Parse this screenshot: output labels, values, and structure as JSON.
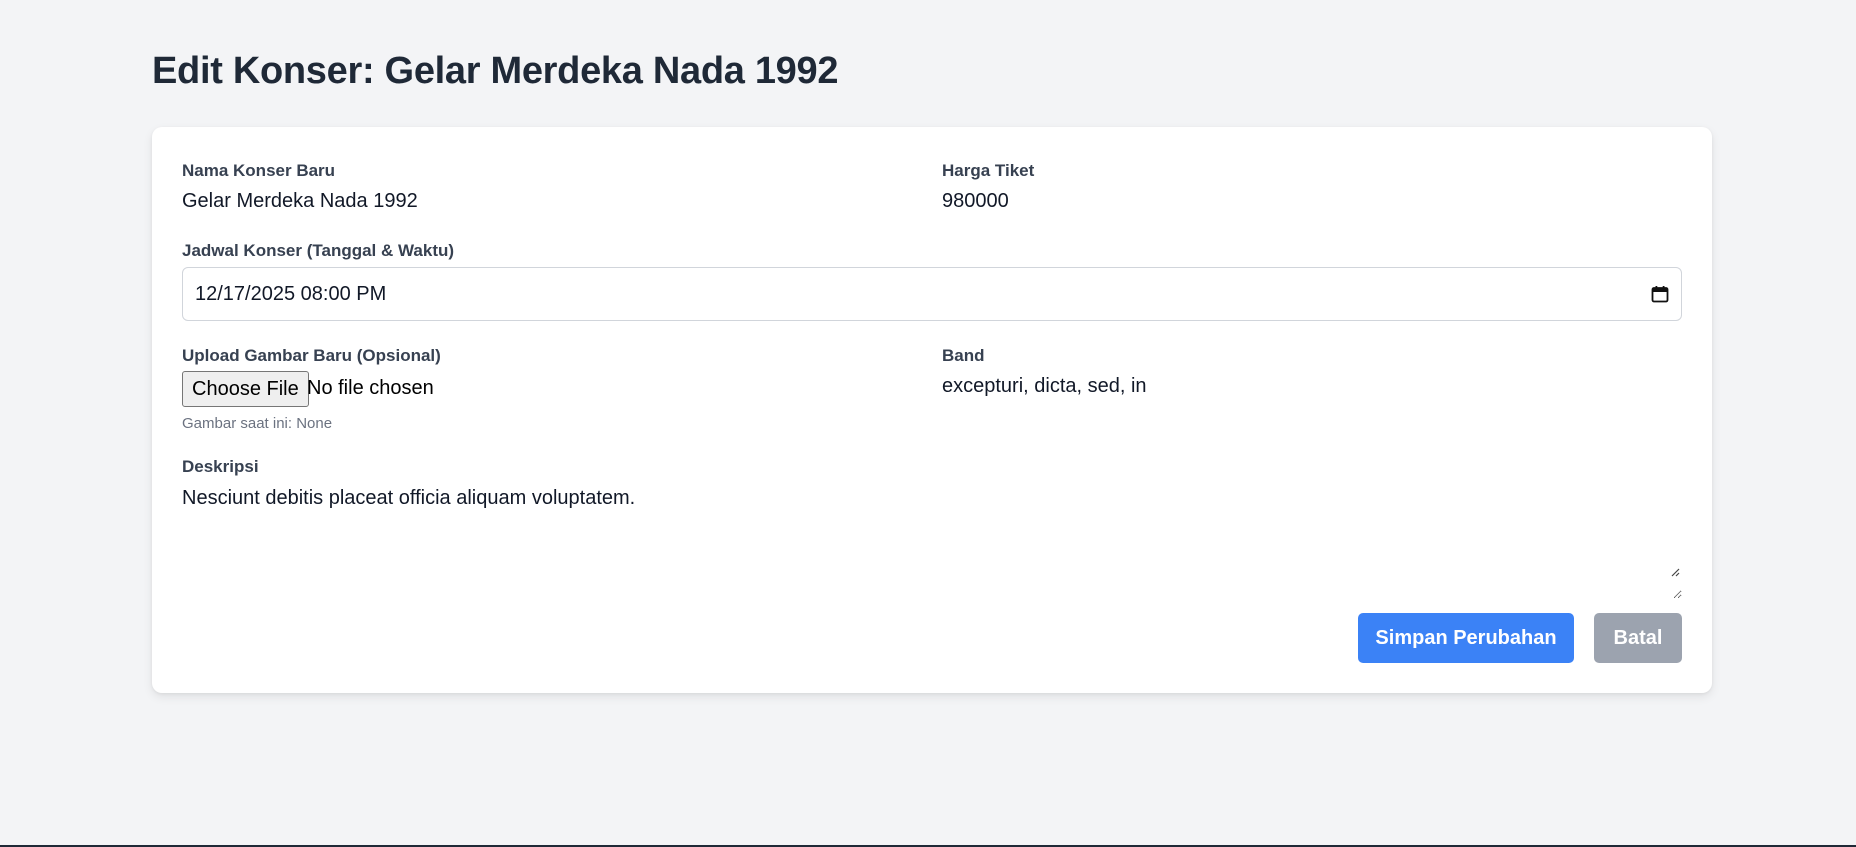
{
  "page": {
    "title": "Edit Konser: Gelar Merdeka Nada 1992"
  },
  "form": {
    "nama_label": "Nama Konser Baru",
    "nama_value": "Gelar Merdeka Nada 1992",
    "harga_label": "Harga Tiket",
    "harga_value": "980000",
    "jadwal_label": "Jadwal Konser (Tanggal & Waktu)",
    "jadwal_value": "12/17/2025 08:00 PM",
    "upload_label": "Upload Gambar Baru (Opsional)",
    "file_button_label": "Choose File",
    "file_status": "No file chosen",
    "current_image_hint": "Gambar saat ini: None",
    "band_label": "Band",
    "band_value": "excepturi, dicta, sed, in",
    "deskripsi_label": "Deskripsi",
    "deskripsi_value": "Nesciunt debitis placeat officia aliquam voluptatem."
  },
  "actions": {
    "save_label": "Simpan Perubahan",
    "cancel_label": "Batal"
  },
  "colors": {
    "background": "#f3f4f6",
    "primary": "#3b82f6",
    "secondary": "#9ca3af",
    "title": "#1f2937"
  },
  "icons": {
    "calendar": "calendar-icon"
  }
}
